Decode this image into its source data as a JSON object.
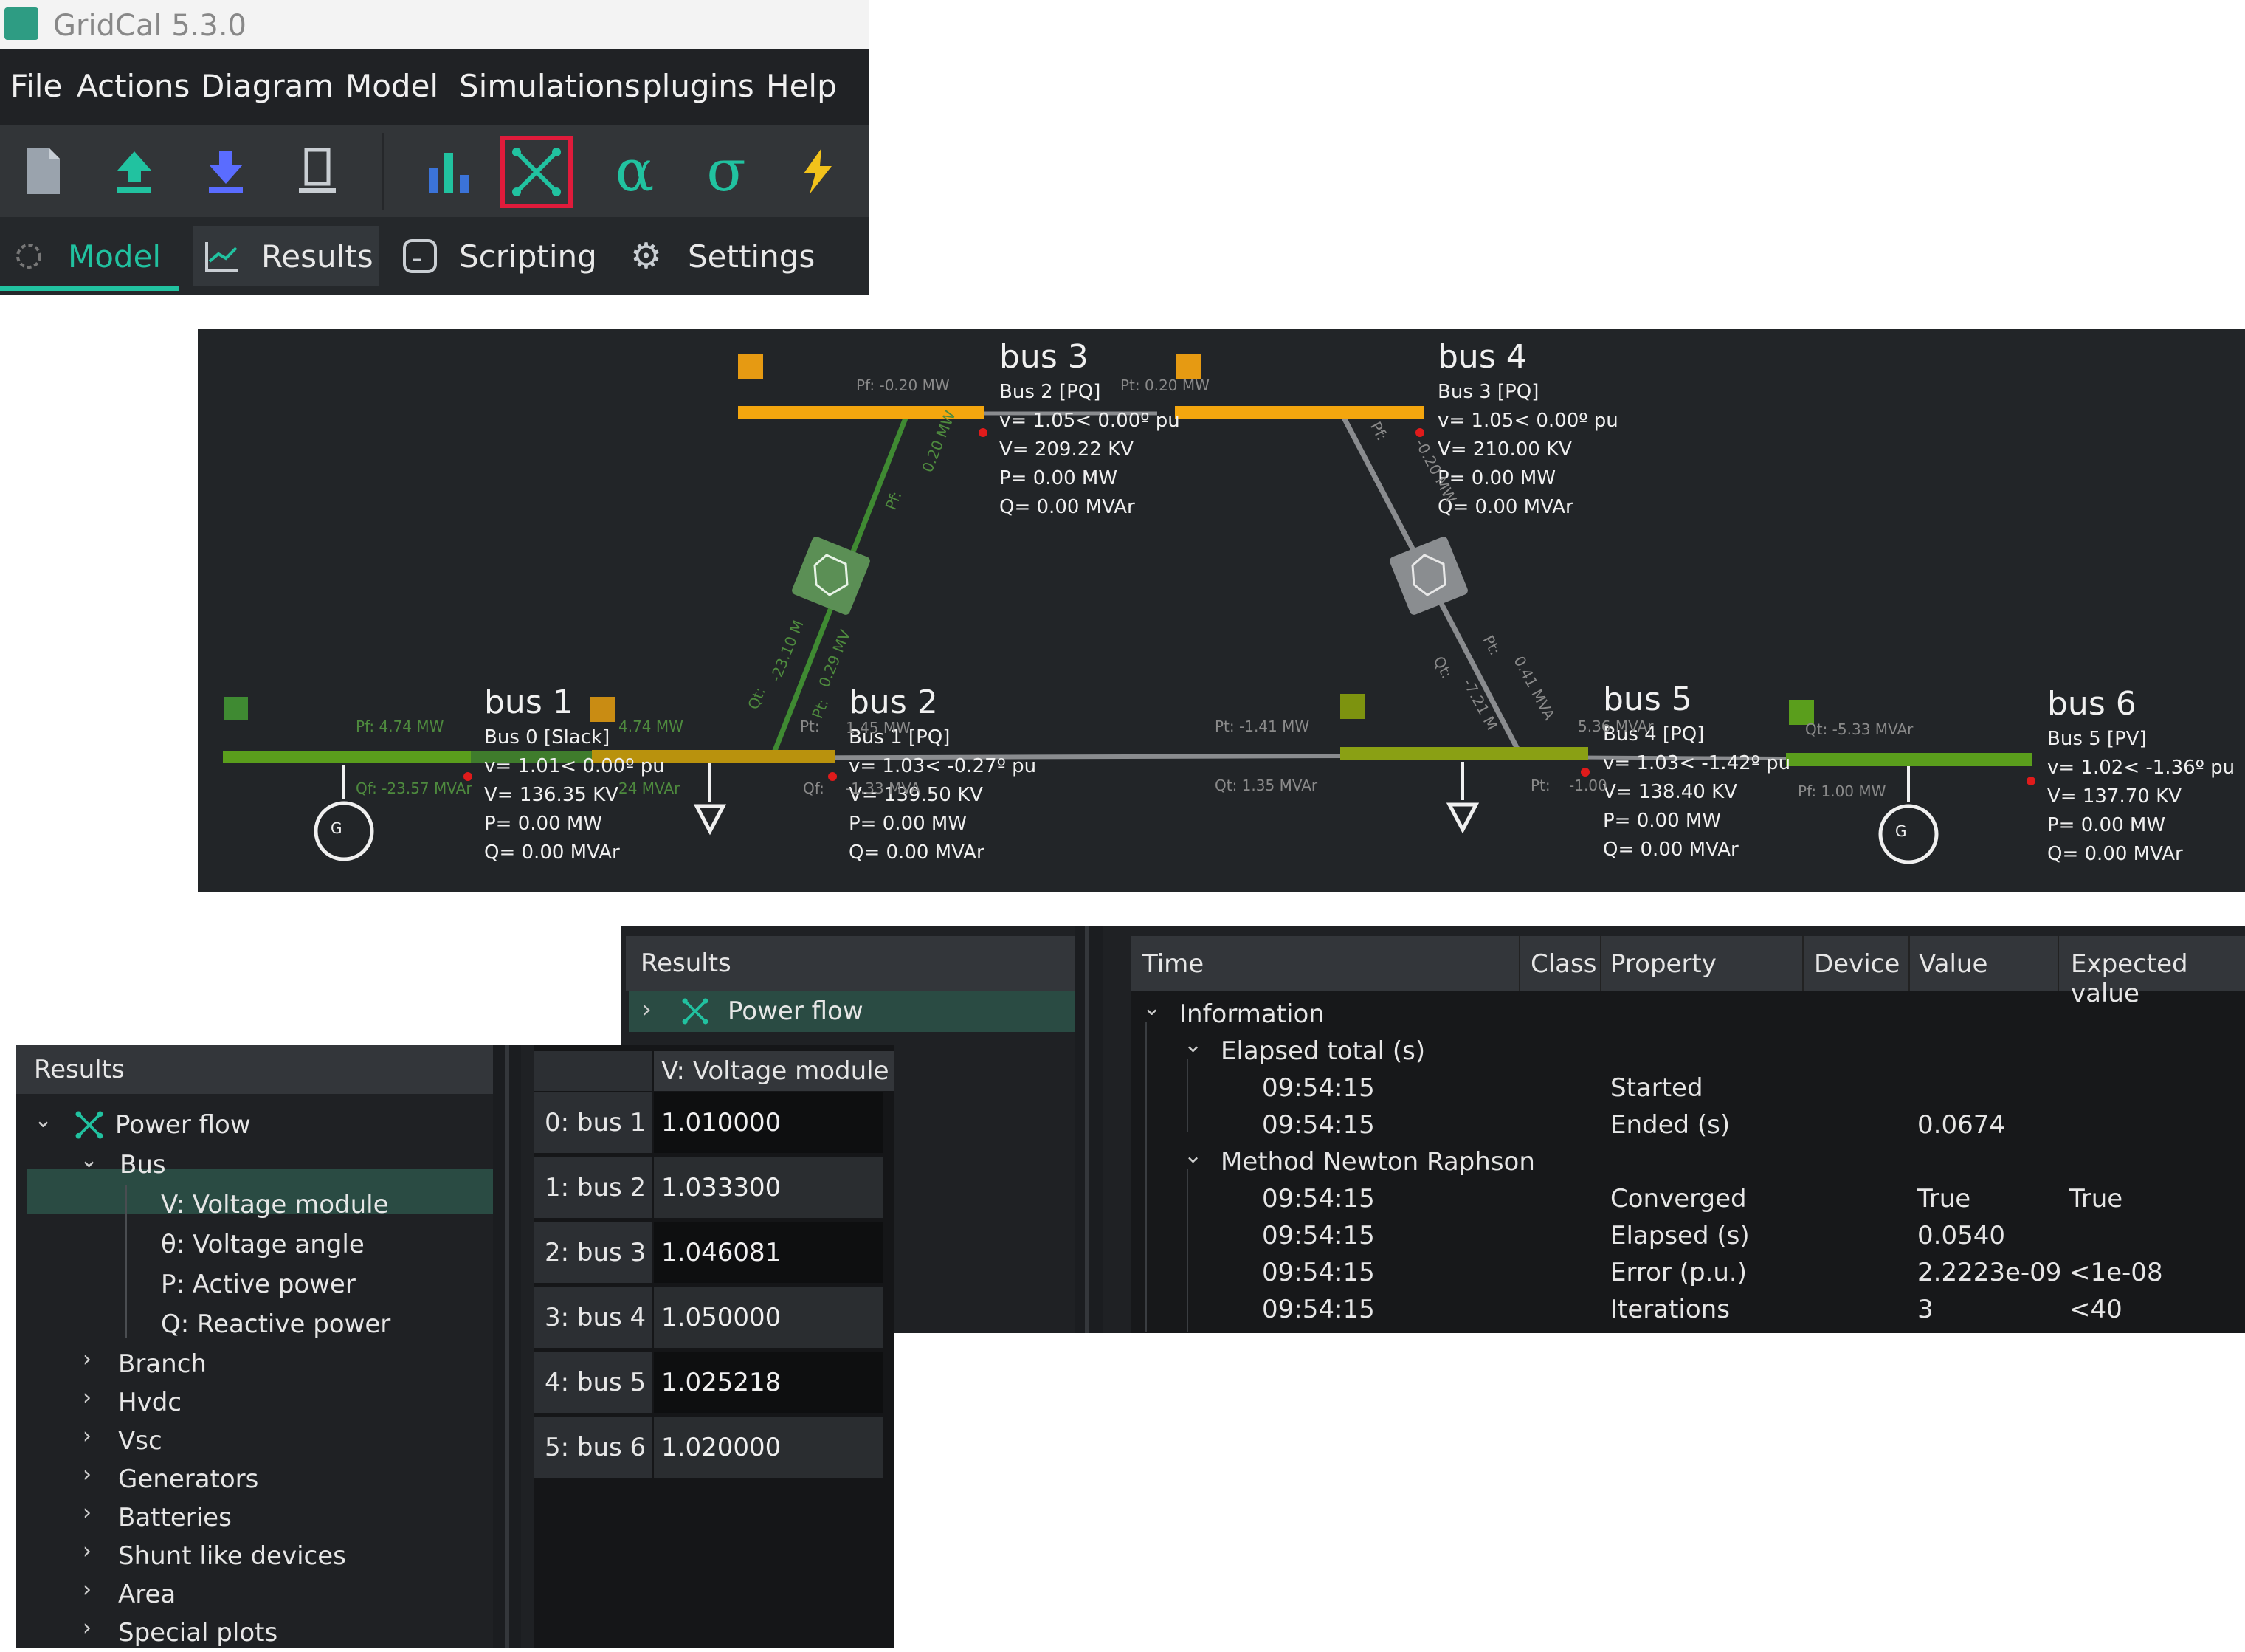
{
  "window": {
    "title": "GridCal 5.3.0"
  },
  "menu": [
    "File",
    "Actions",
    "Diagram",
    "Model",
    "Simulations",
    "plugins",
    "Help"
  ],
  "toolbar": {
    "icons": [
      "new-file-icon",
      "upload-icon",
      "download-icon",
      "device-icon",
      "bar-chart-icon",
      "power-flow-icon",
      "alpha-icon",
      "sigma-icon",
      "lightning-icon"
    ],
    "highlight_color": "#e01b3b"
  },
  "tabs": [
    "Model",
    "Results",
    "Scripting",
    "Settings"
  ],
  "diagram": {
    "buses": [
      {
        "title": "bus 1",
        "info": [
          "Bus 0 [Slack]",
          "v= 1.01< 0.00º pu",
          "V= 136.35 KV",
          "P= 0.00 MW",
          "Q= 0.00 MVAr"
        ]
      },
      {
        "title": "bus 2",
        "info": [
          "Bus 1 [PQ]",
          "v= 1.03< -0.27º pu",
          "V= 139.50 KV",
          "P= 0.00 MW",
          "Q= 0.00 MVAr"
        ]
      },
      {
        "title": "bus 3",
        "info": [
          "Bus 2 [PQ]",
          "v= 1.05< 0.00º pu",
          "V= 209.22 KV",
          "P= 0.00 MW",
          "Q= 0.00 MVAr"
        ]
      },
      {
        "title": "bus 4",
        "info": [
          "Bus 3 [PQ]",
          "v= 1.05< 0.00º pu",
          "V= 210.00 KV",
          "P= 0.00 MW",
          "Q= 0.00 MVAr"
        ]
      },
      {
        "title": "bus 5",
        "info": [
          "Bus 4 [PQ]",
          "v= 1.03< -1.42º pu",
          "V= 138.40 KV",
          "P= 0.00 MW",
          "Q= 0.00 MVAr"
        ]
      },
      {
        "title": "bus 6",
        "info": [
          "Bus 5 [PV]",
          "v= 1.02< -1.36º pu",
          "V= 137.70 KV",
          "P= 0.00 MW",
          "Q= 0.00 MVAr"
        ]
      }
    ],
    "flows": {
      "b1_pf": "Pf:   4.74 MW",
      "b1_qf": "Qf:  -23.57 MVAr",
      "b2_pt": "4.74 MW",
      "b2_qt": "24 MVAr",
      "b3_pf": "Pf:   -0.20 MW",
      "b4_pt": "Pt:   0.20 MW",
      "b2_pt2": "Pt:",
      "b2_qf": "Qf:",
      "mid_pt": "Pt:   -1.41 MW",
      "mid_qt": "Qt:   1.35 MVAr",
      "b5_q": "5.36 MVAr",
      "b5_pt": "Pt:",
      "b5_qt": "-1.00",
      "b6_q": "Qt:   -5.33 MVAr",
      "b6_pf": "Pf:   1.00 MW",
      "diag1a": "0.20 MW",
      "diag1b": "Pf:",
      "diag1c": "-23.10 M",
      "diag1d": "0.29 MV",
      "diag1e": "Qt:",
      "diag1f": "Pt:",
      "diag2a": "Pf:",
      "diag2b": "-0.20 MW",
      "diag2c": "Pt:",
      "diag2d": "Qt:",
      "diag2e": "-7.21 M",
      "diag2f": "0.41 MVA",
      "b2_small": "1.45 MW",
      "b2_small2": "-1.33 MVA"
    },
    "generator_label": "G"
  },
  "results_left": {
    "header": "Results",
    "tree": [
      {
        "label": "Power flow",
        "level": 0,
        "expanded": true
      },
      {
        "label": "Bus",
        "level": 1,
        "expanded": true
      },
      {
        "label": "V: Voltage module",
        "level": 2,
        "selected": true
      },
      {
        "label": "θ: Voltage angle",
        "level": 2
      },
      {
        "label": "P: Active power",
        "level": 2
      },
      {
        "label": "Q: Reactive power",
        "level": 2
      },
      {
        "label": "Branch",
        "level": 1
      },
      {
        "label": "Hvdc",
        "level": 1
      },
      {
        "label": "Vsc",
        "level": 1
      },
      {
        "label": "Generators",
        "level": 1
      },
      {
        "label": "Batteries",
        "level": 1
      },
      {
        "label": "Shunt like devices",
        "level": 1
      },
      {
        "label": "Area",
        "level": 1
      },
      {
        "label": "Special plots",
        "level": 1
      }
    ]
  },
  "voltage_table": {
    "column": "V: Voltage module",
    "rows": [
      {
        "label": "0: bus 1",
        "value": "1.010000"
      },
      {
        "label": "1: bus 2",
        "value": "1.033300"
      },
      {
        "label": "2: bus 3",
        "value": "1.046081"
      },
      {
        "label": "3: bus 4",
        "value": "1.050000"
      },
      {
        "label": "4: bus 5",
        "value": "1.025218"
      },
      {
        "label": "5: bus 6",
        "value": "1.020000"
      }
    ]
  },
  "results_right": {
    "header": "Results",
    "tree": [
      {
        "label": "Power flow"
      }
    ]
  },
  "log": {
    "columns": [
      "Time",
      "Class",
      "Property",
      "Device",
      "Value",
      "Expected value"
    ],
    "groups": [
      {
        "title": "Information"
      },
      {
        "title": "Elapsed total (s)",
        "rows": [
          {
            "time": "09:54:15",
            "property": "Started",
            "value": "",
            "expected": ""
          },
          {
            "time": "09:54:15",
            "property": "Ended (s)",
            "value": "0.0674",
            "expected": ""
          }
        ]
      },
      {
        "title": "Method Newton Raphson",
        "rows": [
          {
            "time": "09:54:15",
            "property": "Converged",
            "value": "True",
            "expected": "True"
          },
          {
            "time": "09:54:15",
            "property": "Elapsed (s)",
            "value": "0.0540",
            "expected": ""
          },
          {
            "time": "09:54:15",
            "property": "Error (p.u.)",
            "value": "2.2223e-09",
            "expected": "<1e-08"
          },
          {
            "time": "09:54:15",
            "property": "Iterations",
            "value": "3",
            "expected": "<40"
          }
        ]
      }
    ]
  }
}
